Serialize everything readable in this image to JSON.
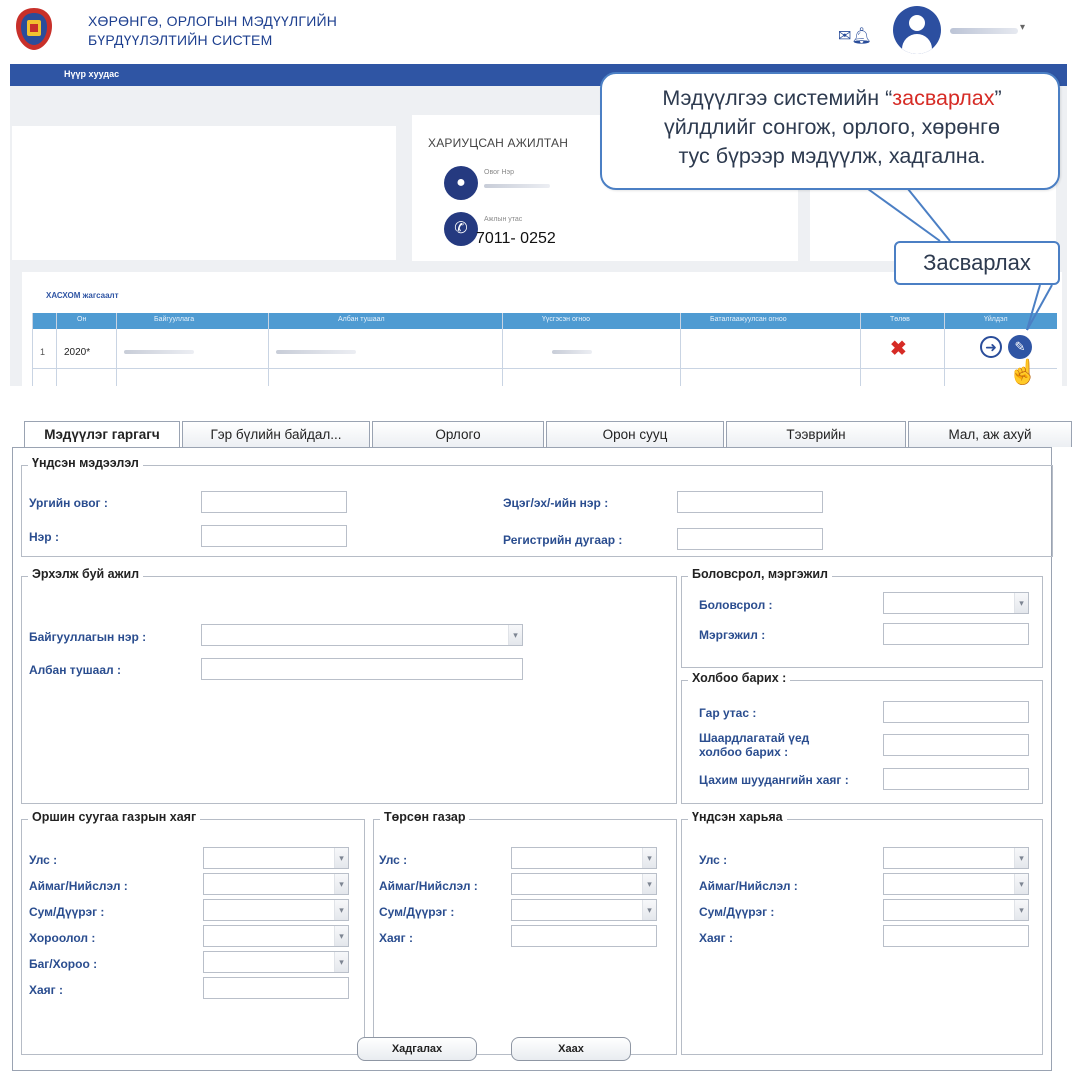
{
  "header": {
    "title_line1": "ХӨРӨНГӨ, ОРЛОГЫН МЭДҮҮЛГИЙН",
    "title_line2": "БҮРДҮҮЛЭЛТИЙН СИСТЕМ",
    "icons": [
      "emblem-logo",
      "mail-icon",
      "bell-icon",
      "avatar-icon",
      "chevron-down-icon"
    ]
  },
  "navbar": {
    "label": "Нүүр хуудас"
  },
  "officer_card": {
    "title": "ХАРИУЦСАН АЖИЛТАН",
    "name_label": "Овог Нэр",
    "phone_label": "Ажлын утас",
    "phone_value": "7011- 0252"
  },
  "callout": {
    "text_before": "Мэдүүлгээ системийн “",
    "text_highlight": "засварлах",
    "text_after": "”",
    "line2": "үйлдлийг сонгож, орлого, хөрөнгө",
    "line3": "тус бүрээр мэдүүлж, хадгална.",
    "edit_tag": "Засварлах",
    "highlight_color": "#d62b25"
  },
  "declarations": {
    "title": "ХАСХОМ жагсаалт",
    "columns": [
      "Он",
      "Байгууллага",
      "Албан тушаал",
      "Үүсгэсэн огноо",
      "Баталгаажуулсан огноо",
      "Төлөв",
      "Үйлдэл"
    ],
    "rows": [
      {
        "num": "1",
        "year": "2020*"
      }
    ]
  },
  "tabs": [
    "Мэдүүлэг гаргагч",
    "Гэр бүлийн байдал...",
    "Орлого",
    "Орон сууц",
    "Тээврийн",
    "Мал, аж ахуй"
  ],
  "form": {
    "basic": {
      "legend": "Үндсэн мэдээлэл",
      "surname": "Ургийн овог :",
      "name": "Нэр :",
      "patronymic": "Эцэг/эх/-ийн нэр :",
      "register": "Регистрийн дугаар :"
    },
    "work": {
      "legend": "Эрхэлж буй ажил",
      "org": "Байгууллагын нэр :",
      "position": "Албан тушаал :"
    },
    "education": {
      "legend": "Боловсрол, мэргэжил",
      "education": "Боловсрол :",
      "profession": "Мэргэжил :"
    },
    "contact": {
      "legend": "Холбоо барих :",
      "mobile": "Гар утас :",
      "emergency_1": "Шаардлагатай үед",
      "emergency_2": "холбоо барих :",
      "email": "Цахим шуудангийн хаяг :"
    },
    "residence": {
      "legend": "Оршин суугаа газрын хаяг",
      "country": "Улс :",
      "province": "Аймаг/Нийслэл :",
      "district": "Сум/Дүүрэг :",
      "khoroo_group": "Хороолол :",
      "bag": "Баг/Хороо :",
      "address": "Хаяг :"
    },
    "birthplace": {
      "legend": "Төрсөн газар",
      "country": "Улс :",
      "province": "Аймаг/Нийслэл :",
      "district": "Сум/Дүүрэг :",
      "address": "Хаяг :"
    },
    "origin": {
      "legend": "Үндсэн харьяа",
      "country": "Улс :",
      "province": "Аймаг/Нийслэл :",
      "district": "Сум/Дүүрэг :",
      "address": "Хаяг :"
    },
    "buttons": {
      "save": "Хадгалах",
      "close": "Хаах"
    }
  },
  "colors": {
    "brand": "#2f55a4",
    "table_header": "#4f9bd2",
    "label": "#2a4d8f",
    "danger": "#d62b25"
  }
}
